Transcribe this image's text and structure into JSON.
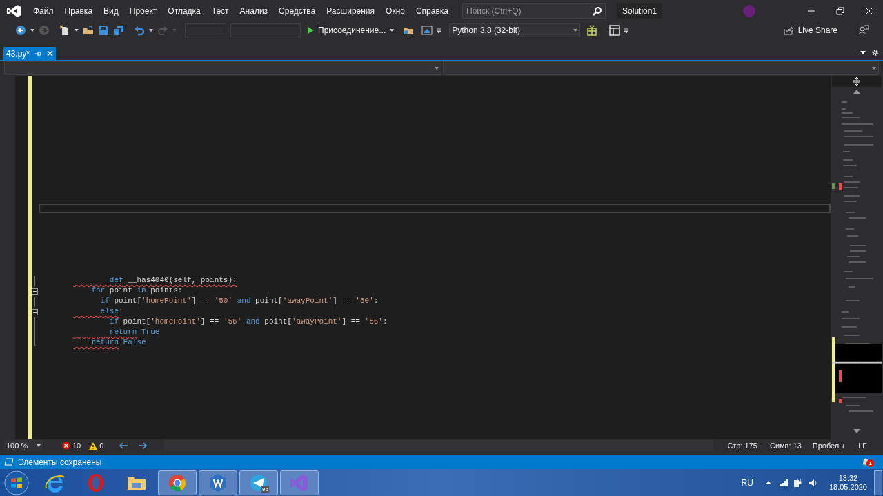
{
  "menu": [
    "Файл",
    "Правка",
    "Вид",
    "Проект",
    "Отладка",
    "Тест",
    "Анализ",
    "Средства",
    "Расширения",
    "Окно",
    "Справка"
  ],
  "search": {
    "placeholder": "Поиск (Ctrl+Q)"
  },
  "solution_name": "Solution1",
  "toolbar": {
    "start_label": "Присоединение...",
    "environment": "Python 3.8 (32-bit)",
    "live_share": "Live Share"
  },
  "tabs": [
    {
      "label": "43.py*",
      "selected": true
    }
  ],
  "code": {
    "lines": [
      {
        "collapsible": false,
        "tokens": [
          {
            "text": "        def",
            "kind": "keyword",
            "error": true
          },
          {
            "text": " __has4040(self, points):",
            "kind": "plain",
            "error": true
          }
        ]
      },
      {
        "collapsible": true,
        "tokens": [
          {
            "text": "    for",
            "kind": "keyword",
            "error": false
          },
          {
            "text": " point ",
            "kind": "plain",
            "error": false
          },
          {
            "text": "in",
            "kind": "keyword",
            "error": false
          },
          {
            "text": " points:",
            "kind": "plain",
            "error": false
          }
        ]
      },
      {
        "collapsible": false,
        "tokens": [
          {
            "text": "      if",
            "kind": "keyword",
            "error": false
          },
          {
            "text": " point[",
            "kind": "plain",
            "error": false
          },
          {
            "text": "'homePoint'",
            "kind": "string",
            "error": false
          },
          {
            "text": "] == ",
            "kind": "plain",
            "error": false
          },
          {
            "text": "'50'",
            "kind": "string",
            "error": false
          },
          {
            "text": " and",
            "kind": "keyword",
            "error": false
          },
          {
            "text": " point[",
            "kind": "plain",
            "error": false
          },
          {
            "text": "'awayPoint'",
            "kind": "string",
            "error": false
          },
          {
            "text": "] == ",
            "kind": "plain",
            "error": false
          },
          {
            "text": "'50'",
            "kind": "string",
            "error": false
          },
          {
            "text": ":",
            "kind": "plain",
            "error": false
          }
        ]
      },
      {
        "collapsible": true,
        "tokens": [
          {
            "text": "      else",
            "kind": "keyword",
            "error": true
          },
          {
            "text": ":",
            "kind": "plain",
            "error": false
          }
        ]
      },
      {
        "collapsible": false,
        "tokens": [
          {
            "text": "        if",
            "kind": "keyword",
            "error": false
          },
          {
            "text": " point[",
            "kind": "plain",
            "error": false
          },
          {
            "text": "'homePoint'",
            "kind": "string",
            "error": false
          },
          {
            "text": "] == ",
            "kind": "plain",
            "error": false
          },
          {
            "text": "'56'",
            "kind": "string",
            "error": false
          },
          {
            "text": " and",
            "kind": "keyword",
            "error": false
          },
          {
            "text": " point[",
            "kind": "plain",
            "error": false
          },
          {
            "text": "'awayPoint'",
            "kind": "string",
            "error": false
          },
          {
            "text": "] == ",
            "kind": "plain",
            "error": false
          },
          {
            "text": "'56'",
            "kind": "string",
            "error": false
          },
          {
            "text": ":",
            "kind": "plain",
            "error": false
          }
        ]
      },
      {
        "collapsible": false,
        "tokens": [
          {
            "text": "        return",
            "kind": "keyword",
            "error": true
          },
          {
            "text": " True",
            "kind": "keyword",
            "error": false
          }
        ]
      },
      {
        "collapsible": false,
        "tokens": [
          {
            "text": "    return",
            "kind": "keyword",
            "error": true
          },
          {
            "text": " False",
            "kind": "keyword",
            "error": false
          }
        ]
      }
    ]
  },
  "editor_status": {
    "zoom": "100 %",
    "errors": "10",
    "warnings": "0",
    "line": "Стр: 175",
    "column": "Симв: 13",
    "indentation": "Пробелы",
    "line_endings": "LF"
  },
  "status_message": "Элементы сохранены",
  "notifications": "1",
  "taskbar": {
    "apps": [
      {
        "kind": "ie",
        "active": false
      },
      {
        "kind": "opera",
        "active": false
      },
      {
        "kind": "folder",
        "active": false
      },
      {
        "kind": "chrome",
        "active": true
      },
      {
        "kind": "w",
        "active": true
      },
      {
        "kind": "telegram",
        "active": true,
        "badge": "95"
      },
      {
        "kind": "vs",
        "active": true
      }
    ],
    "language": "RU",
    "time": "13:32",
    "date": "18.05.2020"
  }
}
